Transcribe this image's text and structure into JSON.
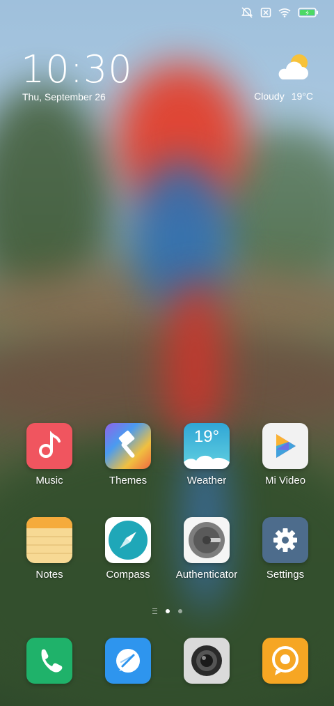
{
  "status": {
    "icons": [
      "alarm-off-icon",
      "sim-off-icon",
      "wifi-icon",
      "battery-charging-icon"
    ]
  },
  "lockclock": {
    "time": "10:30",
    "date": "Thu, September 26"
  },
  "weather": {
    "condition": "Cloudy",
    "temperature": "19°C",
    "icon": "cloudy-sun-icon"
  },
  "apps": [
    {
      "label": "Music",
      "icon": "music-icon",
      "color": "#f0555f"
    },
    {
      "label": "Themes",
      "icon": "themes-icon",
      "color": "#f48b3f"
    },
    {
      "label": "Weather",
      "icon": "weather-icon",
      "color": "#2fb4d4",
      "temp": "19°"
    },
    {
      "label": "Mi Video",
      "icon": "mi-video-icon",
      "color": "#f2f2f2"
    },
    {
      "label": "Notes",
      "icon": "notes-icon",
      "color": "#f7b45a"
    },
    {
      "label": "Compass",
      "icon": "compass-icon",
      "color": "#1fa7b8"
    },
    {
      "label": "Authenticator",
      "icon": "authenticator-icon",
      "color": "#f5f5f5"
    },
    {
      "label": "Settings",
      "icon": "settings-icon",
      "color": "#4d6c8c"
    }
  ],
  "dock": [
    {
      "icon": "phone-icon",
      "color": "#1fb26a"
    },
    {
      "icon": "messages-icon",
      "color": "#2e95ee"
    },
    {
      "icon": "camera-icon",
      "color": "#d9d9d9"
    },
    {
      "icon": "chat-icon",
      "color": "#f6a623"
    }
  ],
  "pages": {
    "count": 2,
    "active": 1
  }
}
